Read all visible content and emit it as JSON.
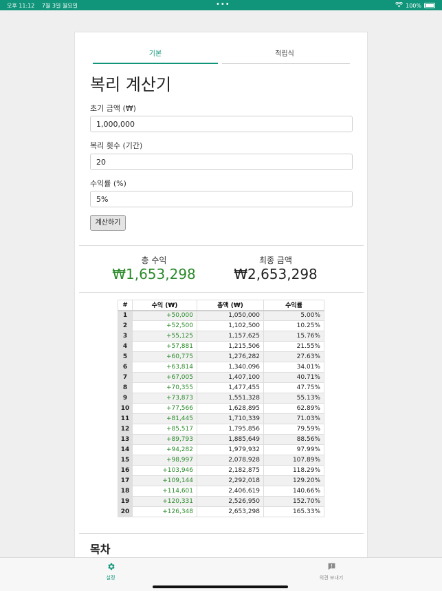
{
  "status_bar": {
    "time": "오후 11:12",
    "date": "7월 3일 월요일",
    "battery_percent": "100%",
    "color": "#10957a"
  },
  "tabs": [
    {
      "label": "기본",
      "active": true
    },
    {
      "label": "적립식",
      "active": false
    }
  ],
  "page_title": "복리 계산기",
  "form": {
    "principal_label": "초기 금액 (₩)",
    "principal_value": "1,000,000",
    "periods_label": "복리 횟수 (기간)",
    "periods_value": "20",
    "rate_label": "수익률 (%)",
    "rate_value": "5%",
    "calculate_label": "계산하기"
  },
  "summary": {
    "total_gain_label": "총 수익",
    "total_gain_value": "₩1,653,298",
    "final_amount_label": "최종 금액",
    "final_amount_value": "₩2,653,298",
    "gain_color": "#2a8a2a"
  },
  "table": {
    "headers": [
      "#",
      "수익 (₩)",
      "총액 (₩)",
      "수익률"
    ],
    "rows": [
      [
        "1",
        "+50,000",
        "1,050,000",
        "5.00%"
      ],
      [
        "2",
        "+52,500",
        "1,102,500",
        "10.25%"
      ],
      [
        "3",
        "+55,125",
        "1,157,625",
        "15.76%"
      ],
      [
        "4",
        "+57,881",
        "1,215,506",
        "21.55%"
      ],
      [
        "5",
        "+60,775",
        "1,276,282",
        "27.63%"
      ],
      [
        "6",
        "+63,814",
        "1,340,096",
        "34.01%"
      ],
      [
        "7",
        "+67,005",
        "1,407,100",
        "40.71%"
      ],
      [
        "8",
        "+70,355",
        "1,477,455",
        "47.75%"
      ],
      [
        "9",
        "+73,873",
        "1,551,328",
        "55.13%"
      ],
      [
        "10",
        "+77,566",
        "1,628,895",
        "62.89%"
      ],
      [
        "11",
        "+81,445",
        "1,710,339",
        "71.03%"
      ],
      [
        "12",
        "+85,517",
        "1,795,856",
        "79.59%"
      ],
      [
        "13",
        "+89,793",
        "1,885,649",
        "88.56%"
      ],
      [
        "14",
        "+94,282",
        "1,979,932",
        "97.99%"
      ],
      [
        "15",
        "+98,997",
        "2,078,928",
        "107.89%"
      ],
      [
        "16",
        "+103,946",
        "2,182,875",
        "118.29%"
      ],
      [
        "17",
        "+109,144",
        "2,292,018",
        "129.20%"
      ],
      [
        "18",
        "+114,601",
        "2,406,619",
        "140.66%"
      ],
      [
        "19",
        "+120,331",
        "2,526,950",
        "152.70%"
      ],
      [
        "20",
        "+126,348",
        "2,653,298",
        "165.33%"
      ]
    ]
  },
  "toc_heading": "목차",
  "tab_bar": {
    "settings_label": "설정",
    "settings_icon": "gear-icon",
    "feedback_label": "의견 보내기",
    "feedback_icon": "feedback-icon"
  }
}
